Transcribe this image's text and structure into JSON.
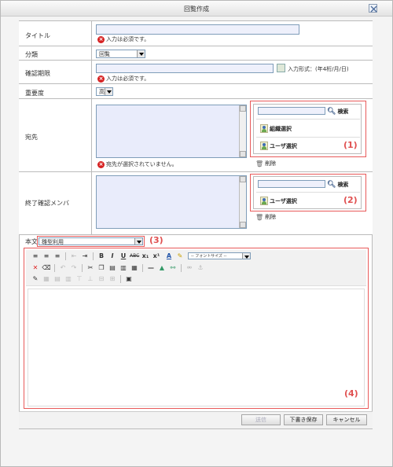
{
  "dialog": {
    "title": "回覧作成"
  },
  "fields": {
    "title": {
      "label": "タイトル",
      "value": "",
      "error": "入力は必須です。"
    },
    "category": {
      "label": "分類",
      "selected": "回覧"
    },
    "deadline": {
      "label": "確認期限",
      "value": "",
      "format_hint": "入力形式：(年4桁/月/日)",
      "error": "入力は必須です。"
    },
    "importance": {
      "label": "重要度",
      "selected": "高"
    },
    "recipients": {
      "label": "宛先",
      "error": "宛先が選択されていません。",
      "search_label": "検索",
      "org_select_label": "組織選択",
      "user_select_label": "ユーザ選択",
      "delete_label": "削除"
    },
    "final_confirm": {
      "label": "終了確認メンバ",
      "search_label": "検索",
      "user_select_label": "ユーザ選択",
      "delete_label": "削除"
    },
    "body": {
      "label": "本文",
      "template_selected": "雛型利用",
      "font_size_placeholder": "-- フォントサイズ --"
    }
  },
  "annotations": [
    "(1)",
    "(2)",
    "(3)",
    "(4)"
  ],
  "footer": {
    "send": "送信",
    "save_draft": "下書き保存",
    "cancel": "キャンセル"
  },
  "colors": {
    "annotation": "#e05050",
    "error": "#d62222",
    "input_bg": "#eef0fb"
  }
}
